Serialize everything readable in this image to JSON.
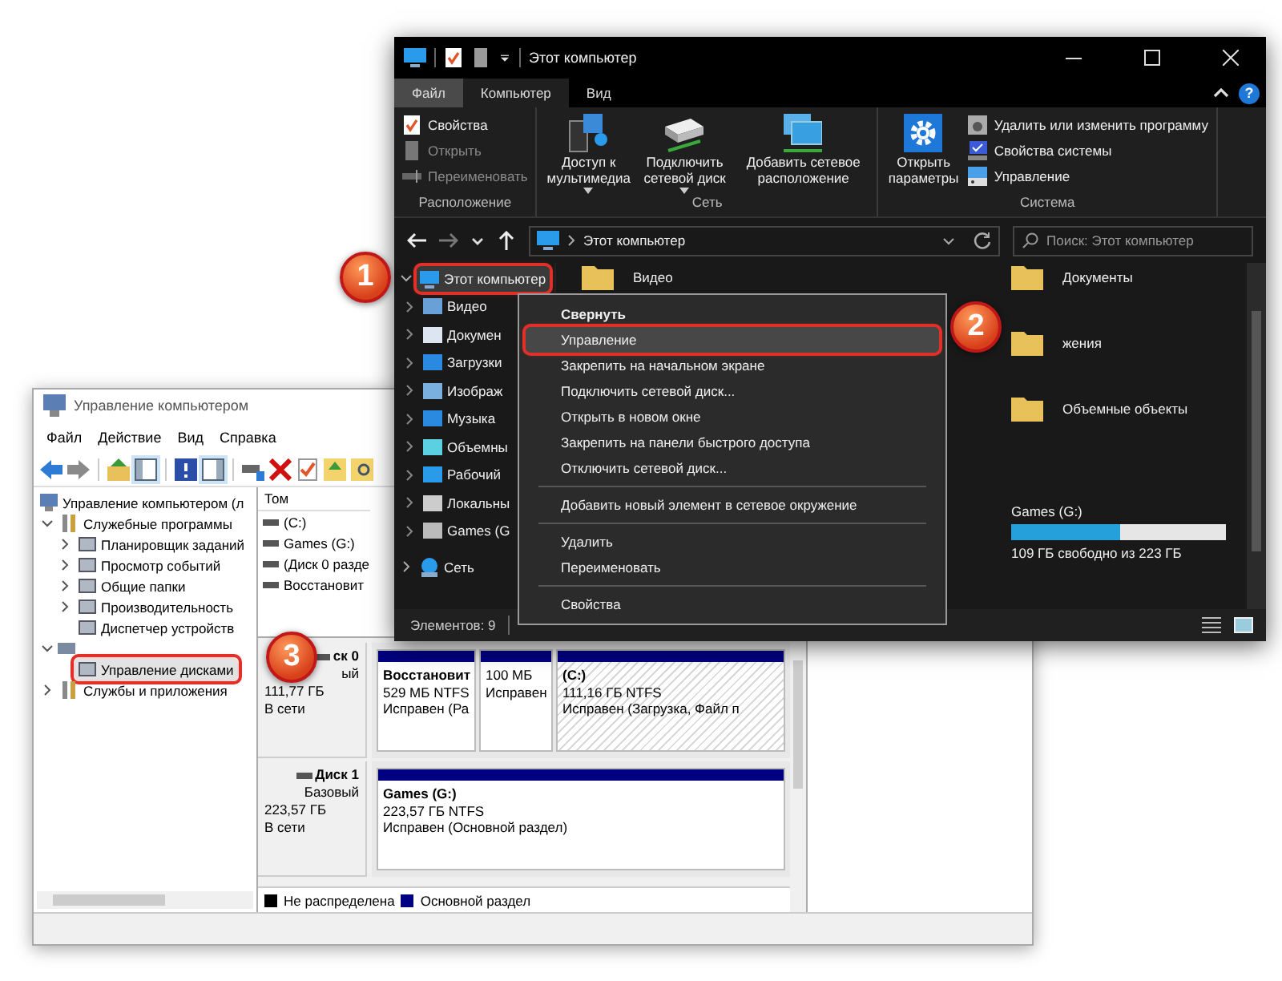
{
  "explorer": {
    "title": "Этот компьютер",
    "help": "?",
    "tabs": [
      {
        "label": "Файл",
        "kind": "file",
        "selected": false
      },
      {
        "label": "Компьютер",
        "kind": "tab",
        "selected": true
      },
      {
        "label": "Вид",
        "kind": "tab",
        "selected": false
      }
    ],
    "ribbon_groups": [
      {
        "label": "Расположение",
        "items": [
          {
            "label": "Свойства",
            "kind": "small",
            "disabled": false
          },
          {
            "label": "Открыть",
            "kind": "small",
            "disabled": true
          },
          {
            "label": "Переименовать",
            "kind": "small",
            "disabled": true
          }
        ]
      },
      {
        "label": "Сеть",
        "items": [
          {
            "label": "Доступ к мультимедиа",
            "kind": "large",
            "disabled": false,
            "dropdown": true
          },
          {
            "label": "Подключить сетевой диск",
            "kind": "large",
            "disabled": false,
            "dropdown": true
          },
          {
            "label": "Добавить сетевое расположение",
            "kind": "large",
            "disabled": false,
            "dropdown": false
          }
        ]
      },
      {
        "label": "Система",
        "items": [
          {
            "label": "Открыть параметры",
            "kind": "large",
            "disabled": false,
            "dropdown": false
          },
          {
            "label": "Удалить или изменить программу",
            "kind": "small",
            "disabled": false
          },
          {
            "label": "Свойства системы",
            "kind": "small",
            "disabled": false
          },
          {
            "label": "Управление",
            "kind": "small",
            "disabled": false
          }
        ]
      }
    ],
    "address": "Этот компьютер",
    "search_placeholder": "Поиск: Этот компьютер",
    "nav": [
      {
        "label": "Этот компьютер",
        "expanded": true,
        "selected": true,
        "children": [
          {
            "label": "Видео",
            "expanded": false,
            "selected": false
          },
          {
            "label": "Докумен",
            "expanded": false,
            "selected": false
          },
          {
            "label": "Загрузки",
            "expanded": false,
            "selected": false
          },
          {
            "label": "Изображ",
            "expanded": false,
            "selected": false
          },
          {
            "label": "Музыка",
            "expanded": false,
            "selected": false
          },
          {
            "label": "Объемны",
            "expanded": false,
            "selected": false
          },
          {
            "label": "Рабочий",
            "expanded": false,
            "selected": false
          },
          {
            "label": "Локальны",
            "expanded": false,
            "selected": false
          },
          {
            "label": "Games (G",
            "expanded": false,
            "selected": false
          }
        ]
      },
      {
        "label": "Сеть",
        "expanded": false,
        "selected": false
      }
    ],
    "content": {
      "column_1": [
        {
          "label": "Видео"
        }
      ],
      "column_2": [
        {
          "label": "Документы"
        },
        {
          "label": "жения"
        },
        {
          "label": "Объемные объекты"
        }
      ],
      "drive": {
        "name": "Games (G:)",
        "level": 0.51,
        "free": "109 ГБ свободно из 223 ГБ"
      }
    },
    "status": "Элементов: 9"
  },
  "context_menu": {
    "items": [
      {
        "kind": "item",
        "label": "Свернуть",
        "default": true,
        "selected": false
      },
      {
        "kind": "item",
        "label": "Управление",
        "default": false,
        "selected": true
      },
      {
        "kind": "item",
        "label": "Закрепить на начальном экране",
        "default": false,
        "selected": false
      },
      {
        "kind": "item",
        "label": "Подключить сетевой диск...",
        "default": false,
        "selected": false
      },
      {
        "kind": "item",
        "label": "Открыть в новом окне",
        "default": false,
        "selected": false
      },
      {
        "kind": "item",
        "label": "Закрепить на панели быстрого доступа",
        "default": false,
        "selected": false
      },
      {
        "kind": "item",
        "label": "Отключить сетевой диск...",
        "default": false,
        "selected": false
      },
      {
        "kind": "separator"
      },
      {
        "kind": "item",
        "label": "Добавить новый элемент в сетевое окружение",
        "default": false,
        "selected": false
      },
      {
        "kind": "separator"
      },
      {
        "kind": "item",
        "label": "Удалить",
        "default": false,
        "selected": false
      },
      {
        "kind": "item",
        "label": "Переименовать",
        "default": false,
        "selected": false
      },
      {
        "kind": "separator"
      },
      {
        "kind": "item",
        "label": "Свойства",
        "default": false,
        "selected": false
      }
    ]
  },
  "computer_management": {
    "title": "Управление компьютером",
    "menu": [
      "Файл",
      "Действие",
      "Вид",
      "Справка"
    ],
    "tree": [
      {
        "label": "Управление компьютером (л",
        "selected": false,
        "children": [
          {
            "label": "Служебные программы",
            "expanded": true,
            "selected": false,
            "children": [
              {
                "label": "Планировщик заданий",
                "expanded": false,
                "selected": false
              },
              {
                "label": "Просмотр событий",
                "expanded": false,
                "selected": false
              },
              {
                "label": "Общие папки",
                "expanded": false,
                "selected": false
              },
              {
                "label": "Производительность",
                "expanded": false,
                "selected": false
              },
              {
                "label": "Диспетчер устройств",
                "selected": false
              }
            ]
          },
          {
            "expanded": true,
            "selected": false,
            "children": [
              {
                "label": "Управление дисками",
                "selected": true
              }
            ]
          },
          {
            "label": "Службы и приложения",
            "expanded": false,
            "selected": false
          }
        ]
      }
    ],
    "list_header": "Том",
    "list_rows": [
      "(C:)",
      "Games (G:)",
      "(Диск 0 разде",
      "Восстановит"
    ],
    "disks": [
      {
        "name": "ск 0",
        "type": "ый",
        "size": "111,77 ГБ",
        "status": "В сети",
        "partitions": [
          {
            "name": "Восстановит",
            "size": "529 МБ NTFS",
            "status": "Исправен (Ра",
            "selected": false
          },
          {
            "size": "100 МБ",
            "status": "Исправен",
            "selected": false
          },
          {
            "name": "(C:)",
            "size": "111,16 ГБ NTFS",
            "status": "Исправен (Загрузка, Файл п",
            "selected": true
          }
        ]
      },
      {
        "name": "Диск 1",
        "type": "Базовый",
        "size": "223,57 ГБ",
        "status": "В сети",
        "partitions": [
          {
            "name": "Games  (G:)",
            "size": "223,57 ГБ NTFS",
            "status": "Исправен (Основной раздел)",
            "selected": false
          }
        ]
      }
    ],
    "legend": [
      {
        "label": "Не распределена",
        "color": "#000000"
      },
      {
        "label": "Основной раздел",
        "color": "#000080"
      }
    ]
  },
  "badges": [
    {
      "label": "1"
    },
    {
      "label": "2"
    },
    {
      "label": "3"
    }
  ]
}
